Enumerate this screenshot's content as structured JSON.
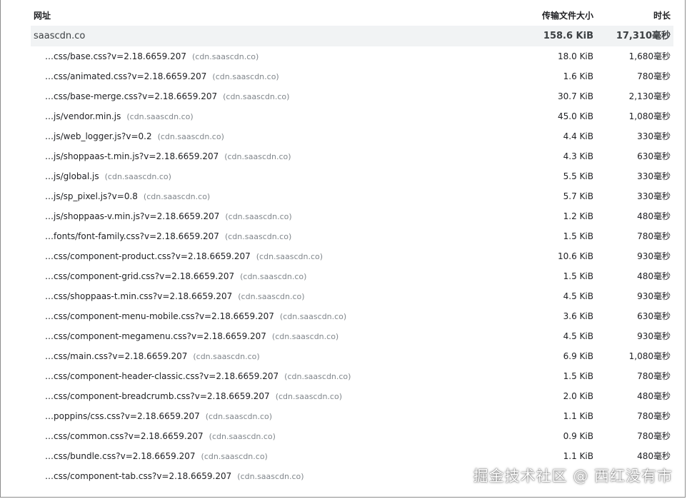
{
  "header": {
    "url_label": "网址",
    "size_label": "传输文件大小",
    "duration_label": "时长"
  },
  "group": {
    "domain": "saascdn.co",
    "size": "158.6 KiB",
    "duration": "17,310毫秒"
  },
  "rows": [
    {
      "path": "…css/base.css?v=2.18.6659.207",
      "host": "(cdn.saascdn.co)",
      "size": "18.0 KiB",
      "duration": "1,680毫秒"
    },
    {
      "path": "…css/animated.css?v=2.18.6659.207",
      "host": "(cdn.saascdn.co)",
      "size": "1.6 KiB",
      "duration": "780毫秒"
    },
    {
      "path": "…css/base-merge.css?v=2.18.6659.207",
      "host": "(cdn.saascdn.co)",
      "size": "30.7 KiB",
      "duration": "2,130毫秒"
    },
    {
      "path": "…js/vendor.min.js",
      "host": "(cdn.saascdn.co)",
      "size": "45.0 KiB",
      "duration": "1,080毫秒"
    },
    {
      "path": "…js/web_logger.js?v=0.2",
      "host": "(cdn.saascdn.co)",
      "size": "4.4 KiB",
      "duration": "330毫秒"
    },
    {
      "path": "…js/shoppaas-t.min.js?v=2.18.6659.207",
      "host": "(cdn.saascdn.co)",
      "size": "4.3 KiB",
      "duration": "630毫秒"
    },
    {
      "path": "…js/global.js",
      "host": "(cdn.saascdn.co)",
      "size": "5.5 KiB",
      "duration": "330毫秒"
    },
    {
      "path": "…js/sp_pixel.js?v=0.8",
      "host": "(cdn.saascdn.co)",
      "size": "5.7 KiB",
      "duration": "330毫秒"
    },
    {
      "path": "…js/shoppaas-v.min.js?v=2.18.6659.207",
      "host": "(cdn.saascdn.co)",
      "size": "1.2 KiB",
      "duration": "480毫秒"
    },
    {
      "path": "…fonts/font-family.css?v=2.18.6659.207",
      "host": "(cdn.saascdn.co)",
      "size": "1.5 KiB",
      "duration": "780毫秒"
    },
    {
      "path": "…css/component-product.css?v=2.18.6659.207",
      "host": "(cdn.saascdn.co)",
      "size": "10.6 KiB",
      "duration": "930毫秒"
    },
    {
      "path": "…css/component-grid.css?v=2.18.6659.207",
      "host": "(cdn.saascdn.co)",
      "size": "1.5 KiB",
      "duration": "480毫秒"
    },
    {
      "path": "…css/shoppaas-t.min.css?v=2.18.6659.207",
      "host": "(cdn.saascdn.co)",
      "size": "4.5 KiB",
      "duration": "930毫秒"
    },
    {
      "path": "…css/component-menu-mobile.css?v=2.18.6659.207",
      "host": "(cdn.saascdn.co)",
      "size": "3.6 KiB",
      "duration": "630毫秒"
    },
    {
      "path": "…css/component-megamenu.css?v=2.18.6659.207",
      "host": "(cdn.saascdn.co)",
      "size": "4.5 KiB",
      "duration": "930毫秒"
    },
    {
      "path": "…css/main.css?v=2.18.6659.207",
      "host": "(cdn.saascdn.co)",
      "size": "6.9 KiB",
      "duration": "1,080毫秒"
    },
    {
      "path": "…css/component-header-classic.css?v=2.18.6659.207",
      "host": "(cdn.saascdn.co)",
      "size": "1.5 KiB",
      "duration": "780毫秒"
    },
    {
      "path": "…css/component-breadcrumb.css?v=2.18.6659.207",
      "host": "(cdn.saascdn.co)",
      "size": "2.0 KiB",
      "duration": "480毫秒"
    },
    {
      "path": "…poppins/css.css?v=2.18.6659.207",
      "host": "(cdn.saascdn.co)",
      "size": "1.1 KiB",
      "duration": "780毫秒"
    },
    {
      "path": "…css/common.css?v=2.18.6659.207",
      "host": "(cdn.saascdn.co)",
      "size": "0.9 KiB",
      "duration": "780毫秒"
    },
    {
      "path": "…css/bundle.css?v=2.18.6659.207",
      "host": "(cdn.saascdn.co)",
      "size": "1.1 KiB",
      "duration": "480毫秒"
    },
    {
      "path": "…css/component-tab.css?v=2.18.6659.207",
      "host": "(cdn.saascdn.co)",
      "size": "",
      "duration": ""
    }
  ],
  "watermark": "掘金技术社区 @ 西红没有市"
}
